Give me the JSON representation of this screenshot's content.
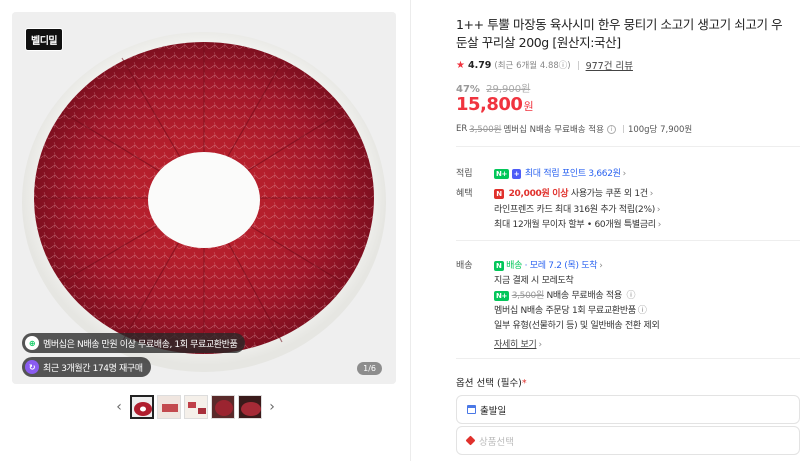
{
  "gallery": {
    "brand_logo": "벨디밀",
    "badges": [
      {
        "text": "멤버십은 N배송 만원 이상 무료배송, 1회 무료교환반품",
        "icon": "membership-icon"
      },
      {
        "text": "최근 3개월간 174명 재구매",
        "icon": "repurchase-icon"
      }
    ],
    "counter": "1/6",
    "prev_arrow": "‹",
    "next_arrow": "›",
    "thumbnail_count": 5,
    "active_thumbnail": 1
  },
  "product": {
    "title": "1++ 투뿔 마장동 육사시미 한우 뭉티기 소고기 생고기 쇠고기 우둔살 꾸리살 200g [원산지:국산]",
    "rating": "4.79",
    "rating_sub": "(최근 6개월 4.88ⓘ)",
    "reviews": "977건 리뷰",
    "discount_pct": "47%",
    "original_price": "29,900원",
    "price": "15,800",
    "price_unit": "원",
    "shipping": {
      "prefix": "ER",
      "fee_strike": "3,500원",
      "text": "멤버십 N배송 무료배송 적용",
      "per_unit": "100g당 7,900원"
    }
  },
  "benefits": {
    "points_label": "적립",
    "points_tag_n": "N+",
    "points_tag_plus": "+",
    "points_text": "최대 적립 포인트 3,662원",
    "perks_label": "혜택",
    "perks_line1_amount": "20,000원 이상",
    "perks_line1_rest": "사용가능 쿠폰 외 1건",
    "perks_line2": "라인프렌즈 카드 최대 316원 추가 적립(2%)",
    "perks_line3": "최대 12개월 무이자 할부 • 60개월 특별금리"
  },
  "delivery": {
    "label": "배송",
    "tag": "N",
    "type": "배송",
    "eta": "· 모레 7.2 (목) 도착",
    "eta_sub": "지금 결제 시 모레도착",
    "free_fee_strike": "3,500원",
    "free_text": "N배송 무료배송 적용",
    "exchange": "멤버십 N배송 주문당 1회 무료교환반품",
    "exception": "일부 유형(선물하기 등) 및 일반배송 전환 제외",
    "details_link": "자세히 보기"
  },
  "options": {
    "title": "옵션 선택 (필수)",
    "required_mark": "*",
    "option1": "출발일",
    "option2_placeholder": "상품선택"
  },
  "colors": {
    "accent_red": "#f0343f",
    "naver_green": "#03c75a",
    "link_blue": "#2c64f0"
  }
}
